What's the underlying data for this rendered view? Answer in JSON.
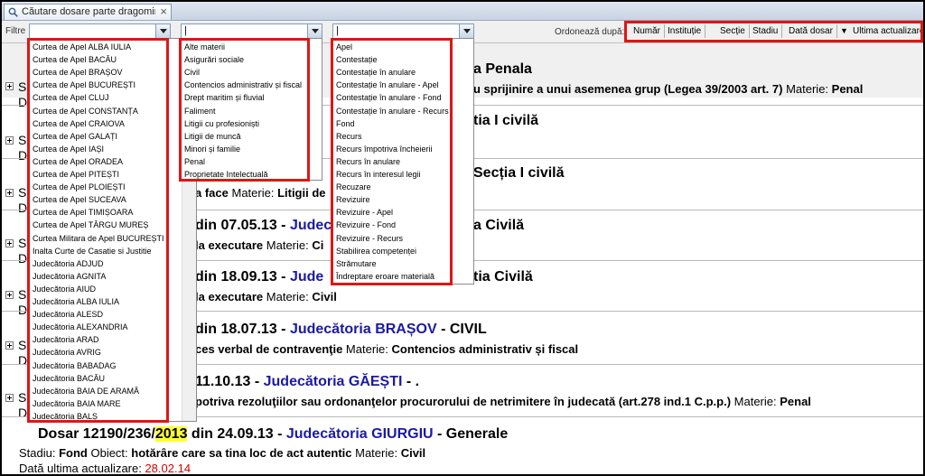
{
  "tab": {
    "title": "Căutare dosare parte dragomires...",
    "close": "×"
  },
  "filters": {
    "label": "Filtre",
    "combo3_value": "|"
  },
  "sort": {
    "label": "Ordonează după:",
    "buttons": [
      "Număr",
      "Instituție",
      "Secție",
      "Stadiu",
      "Dată dosar",
      "Ultima actualizare"
    ],
    "sort_arrow": "▼"
  },
  "institutions": [
    "Curtea de Apel ALBA IULIA",
    "Curtea de Apel BACĂU",
    "Curtea de Apel BRAȘOV",
    "Curtea de Apel BUCUREȘTI",
    "Curtea de Apel CLUJ",
    "Curtea de Apel CONSTANȚA",
    "Curtea de Apel CRAIOVA",
    "Curtea de Apel GALAȚI",
    "Curtea de Apel IAȘI",
    "Curtea de Apel ORADEA",
    "Curtea de Apel PITEȘTI",
    "Curtea de Apel PLOIEȘTI",
    "Curtea de Apel SUCEAVA",
    "Curtea de Apel TIMIȘOARA",
    "Curtea de Apel TÂRGU MUREȘ",
    "Curtea Militara de Apel BUCUREȘTI",
    "Inalta Curte de Casatie si Justitie",
    "Judecătoria ADJUD",
    "Judecătoria AGNITA",
    "Judecătoria AIUD",
    "Judecătoria ALBA IULIA",
    "Judecătoria ALESD",
    "Judecătoria ALEXANDRIA",
    "Judecătoria ARAD",
    "Judecătoria AVRIG",
    "Judecătoria BABADAG",
    "Judecătoria BACĂU",
    "Judecătoria BAIA DE ARAMĂ",
    "Judecătoria BAIA MARE",
    "Judecătoria BALȘ"
  ],
  "materii": [
    "Alte materii",
    "Asigurări sociale",
    "Civil",
    "Contencios administrativ și fiscal",
    "Drept maritim și fluvial",
    "Faliment",
    "Litigii cu profesioniști",
    "Litigii de muncă",
    "Minori și familie",
    "Penal",
    "Proprietate Intelectuală"
  ],
  "stadii": [
    "Apel",
    "Contestație",
    "Contestație în anulare",
    "Contestație în anulare - Apel",
    "Contestație în anulare - Fond",
    "Contestație în anulare - Recurs",
    "Fond",
    "Recurs",
    "Recurs împotriva încheierii",
    "Recurs în anulare",
    "Recurs în interesul legii",
    "Recuzare",
    "Revizuire",
    "Revizuire - Apel",
    "Revizuire - Fond",
    "Revizuire - Recurs",
    "Stabilirea competenței",
    "Strămutare",
    "Îndreptare eroare materială"
  ],
  "records": [
    {
      "title_sep": " - ",
      "court": "",
      "section": "a Penala",
      "detail_pre": "",
      "detail_bold": "u sprijinire a unui asemenea grup (Legea 39/2003 art. 7)",
      "detail_post": " Materie: ",
      "materie": "Penal",
      "stub1": "S",
      "stub2": "D"
    },
    {
      "title_sep": " - ",
      "court": "",
      "section": "tia I civilă",
      "detail_bold": "",
      "stub1": "S",
      "stub2": "D"
    },
    {
      "section": "Secția I civilă",
      "detail_bold": "a face",
      "detail_post": " Materie: ",
      "materie": "Litigii de",
      "stub1": "S",
      "stub2": "D"
    },
    {
      "date": "din 07.05.13",
      "court": "Judecătoria",
      "section": "a Civilă",
      "detail_bold": "la executare",
      "detail_post": " Materie: ",
      "materie": "Ci",
      "stub1": "S",
      "stub2": "D"
    },
    {
      "date": "din 18.09.13",
      "court": "Jude",
      "section": "tia Civilă",
      "detail_bold": "la executare",
      "detail_post": " Materie: ",
      "materie": "Civil",
      "stub1": "S",
      "stub2": "D"
    },
    {
      "date": "din 18.07.13",
      "court": "Judecătoria BRAȘOV",
      "section": "CIVIL",
      "detail_bold": "ces verbal de contravenţie",
      "detail_post": " Materie: ",
      "materie": "Contencios administrativ și fiscal",
      "stub1": "S",
      "stub2": "D"
    },
    {
      "date": "11.10.13",
      "court": "Judecătoria GĂEȘTI",
      "section": ".",
      "detail_bold": "potriva rezoluţiilor sau ordonanţelor procurorului de netrimitere în judecată (art.278 ind.1 C.p.p.)",
      "detail_post": " Materie: ",
      "materie": "Penal",
      "stub1": "S",
      "stub2": "D"
    },
    {
      "dosar_prefix": "Dosar 12190/236/",
      "year": "2013",
      "date": " din 24.09.13",
      "court": "Judecătoria GIURGIU",
      "section": "Generale",
      "stadiu_label": "Stadiu: ",
      "stadiu": "Fond",
      "obiect_label": " Obiect: ",
      "obiect": "hotărâre care sa tina loc de act autentic",
      "detail_post": " Materie: ",
      "materie": "Civil",
      "update_label": "Dată ultima actualizare: ",
      "update": "28.02.14"
    }
  ],
  "colors": {
    "highlight": "#e01515",
    "court": "#1a1aa6",
    "year_highlight": "#ffff33",
    "update_date": "#d40000"
  }
}
